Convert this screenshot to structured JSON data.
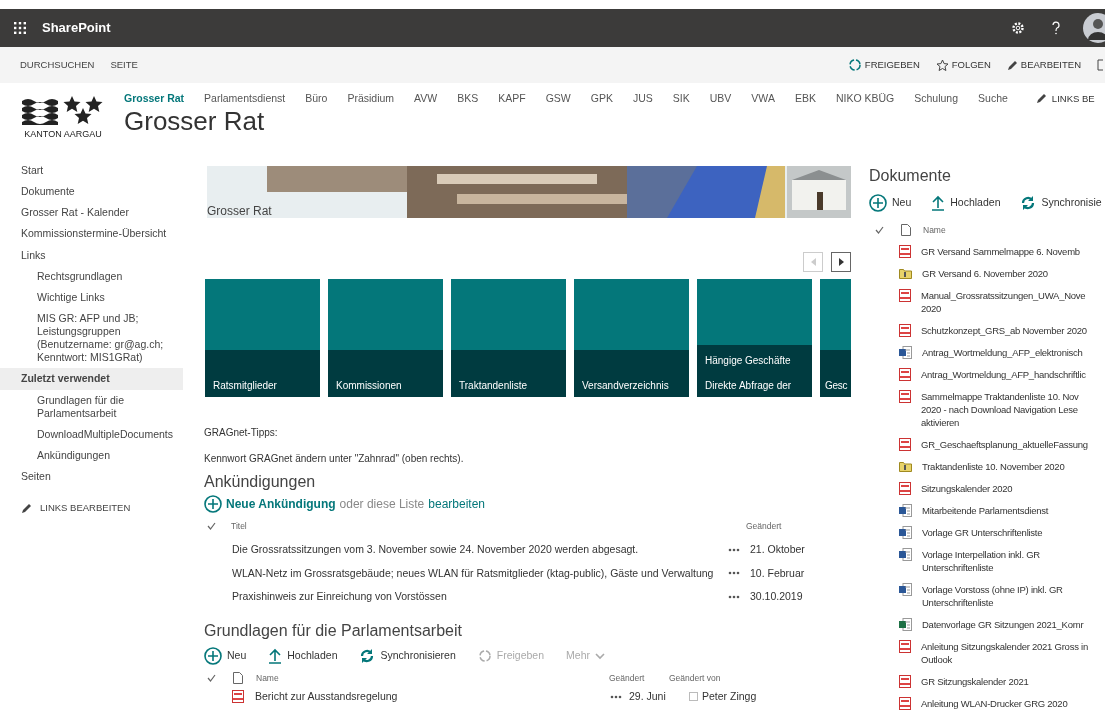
{
  "suite_bar": {
    "app_name": "SharePoint"
  },
  "ribbon": {
    "left": [
      "DURCHSUCHEN",
      "SEITE"
    ],
    "right": [
      {
        "label": "FREIGEBEN",
        "kind": "share"
      },
      {
        "label": "FOLGEN",
        "kind": "follow"
      },
      {
        "label": "BEARBEITEN",
        "kind": "edit"
      }
    ]
  },
  "logo": {
    "text": "KANTON AARGAU"
  },
  "top_nav": [
    {
      "label": "Grosser Rat",
      "selected": true
    },
    {
      "label": "Parlamentsdienst",
      "selected": false
    },
    {
      "label": "Büro",
      "selected": false
    },
    {
      "label": "Präsidium",
      "selected": false
    },
    {
      "label": "AVW",
      "selected": false
    },
    {
      "label": "BKS",
      "selected": false
    },
    {
      "label": "KAPF",
      "selected": false
    },
    {
      "label": "GSW",
      "selected": false
    },
    {
      "label": "GPK",
      "selected": false
    },
    {
      "label": "JUS",
      "selected": false
    },
    {
      "label": "SIK",
      "selected": false
    },
    {
      "label": "UBV",
      "selected": false
    },
    {
      "label": "VWA",
      "selected": false
    },
    {
      "label": "EBK",
      "selected": false
    },
    {
      "label": "NIKO KBÜG",
      "selected": false
    },
    {
      "label": "Schulung",
      "selected": false
    },
    {
      "label": "Suche",
      "selected": false
    }
  ],
  "top_nav_edit": "LINKS BE",
  "site_title": "Grosser Rat",
  "sidebar": {
    "items": [
      {
        "label": "Start",
        "selected": false
      },
      {
        "label": "Dokumente",
        "selected": false
      },
      {
        "label": "Grosser Rat - Kalender",
        "selected": false
      },
      {
        "label": "Kommissionstermine-Übersicht",
        "selected": false
      },
      {
        "label": "Links",
        "selected": false,
        "children": [
          {
            "label": "Rechtsgrundlagen",
            "selected": false
          },
          {
            "label": "Wichtige Links",
            "selected": false
          },
          {
            "label": "MIS GR: AFP und JB; Leistungsgruppen (Benutzername: gr@ag.ch; Kenntwort: MIS1GRat)",
            "selected": false
          }
        ]
      },
      {
        "label": "Zuletzt verwendet",
        "selected": true,
        "children": [
          {
            "label": "Grundlagen für die Parlamentsarbeit",
            "selected": false
          },
          {
            "label": "DownloadMultipleDocuments",
            "selected": false
          },
          {
            "label": "Ankündigungen",
            "selected": false
          }
        ]
      },
      {
        "label": "Seiten",
        "selected": false
      }
    ],
    "edit_link": "LINKS BEARBEITEN"
  },
  "banner": {
    "caption": "Grosser Rat"
  },
  "tile_pager": [
    {
      "kind": "prev",
      "disabled": true
    },
    {
      "kind": "next",
      "disabled": false
    }
  ],
  "tiles": [
    {
      "label": "Ratsmitglieder"
    },
    {
      "label": "Kommissionen"
    },
    {
      "label": "Traktandenliste"
    },
    {
      "label": "Versandverzeichnis"
    },
    {
      "label": "Hängige Geschäfte",
      "description": "Direkte Abfrage der"
    },
    {
      "label": "Gesc"
    }
  ],
  "tips": [
    "GRAGnet-Tipps:",
    "Kennwort GRAGnet ändern unter \"Zahnrad\" (oben rechts)."
  ],
  "announcements": {
    "title": "Ankündigungen",
    "new_link": "Neue Ankündigung",
    "or_text": "oder diese Liste",
    "edit_link": "bearbeiten",
    "columns": [
      "Titel",
      "Geändert"
    ],
    "rows": [
      {
        "title": "Die Grossratssitzungen vom 3. November sowie 24. November 2020 werden abgesagt.",
        "modified": "21. Oktober"
      },
      {
        "title": "WLAN-Netz im Grossratsgebäude; neues WLAN für Ratsmitglieder (ktag-public), Gäste und Verwaltung",
        "modified": "10. Februar"
      },
      {
        "title": "Praxishinweis zur Einreichung von Vorstössen",
        "modified": "30.10.2019"
      }
    ]
  },
  "library": {
    "title": "Grundlagen für die Parlamentsarbeit",
    "toolbar": [
      {
        "label": "Neu",
        "kind": "new",
        "disabled": false
      },
      {
        "label": "Hochladen",
        "kind": "upload",
        "disabled": false
      },
      {
        "label": "Synchronisieren",
        "kind": "sync",
        "disabled": false
      },
      {
        "label": "Freigeben",
        "kind": "share",
        "disabled": true
      },
      {
        "label": "Mehr",
        "kind": "more",
        "disabled": true
      }
    ],
    "columns": [
      "Name",
      "Geändert",
      "Geändert von"
    ],
    "rows": [
      {
        "name": "Bericht zur Ausstandsregelung",
        "kind": "pdf",
        "modified": "29. Juni",
        "modified_by": "Peter Zingg"
      }
    ]
  },
  "documents": {
    "title": "Dokumente",
    "toolbar": [
      {
        "label": "Neu",
        "kind": "new",
        "disabled": false
      },
      {
        "label": "Hochladen",
        "kind": "upload",
        "disabled": false
      },
      {
        "label": "Synchronisie",
        "kind": "sync",
        "disabled": false
      }
    ],
    "columns": [
      "Name"
    ],
    "rows": [
      {
        "name": "GR Versand Sammelmappe 6. Novemb",
        "kind": "pdf"
      },
      {
        "name": "GR Versand 6. November 2020",
        "kind": "zip"
      },
      {
        "name": "Manual_Grossratssitzungen_UWA_Nove 2020",
        "kind": "pdf"
      },
      {
        "name": "Schutzkonzept_GRS_ab November 2020",
        "kind": "pdf"
      },
      {
        "name": "Antrag_Wortmeldung_AFP_elektronisch",
        "kind": "word"
      },
      {
        "name": "Antrag_Wortmeldung_AFP_handschriftlic",
        "kind": "pdf"
      },
      {
        "name": "Sammelmappe Traktandenliste 10. Nov 2020 - nach Download Navigation Lese aktivieren",
        "kind": "pdf"
      },
      {
        "name": "GR_Geschaeftsplanung_aktuelleFassung",
        "kind": "pdf"
      },
      {
        "name": "Traktandenliste 10. November 2020",
        "kind": "zip"
      },
      {
        "name": "Sitzungskalender 2020",
        "kind": "pdf"
      },
      {
        "name": "Mitarbeitende Parlamentsdienst",
        "kind": "word"
      },
      {
        "name": "Vorlage GR Unterschriftenliste",
        "kind": "word"
      },
      {
        "name": "Vorlage Interpellation inkl. GR Unterschriftenliste",
        "kind": "word"
      },
      {
        "name": "Vorlage Vorstoss (ohne IP) inkl. GR Unterschriftenliste",
        "kind": "word"
      },
      {
        "name": "Datenvorlage GR Sitzungen 2021_Komr",
        "kind": "excel"
      },
      {
        "name": "Anleitung Sitzungskalender 2021 Gross in Outlook",
        "kind": "pdf"
      },
      {
        "name": "GR Sitzungskalender 2021",
        "kind": "pdf"
      },
      {
        "name": "Anleitung WLAN-Drucker GRG 2020",
        "kind": "pdf"
      }
    ]
  }
}
